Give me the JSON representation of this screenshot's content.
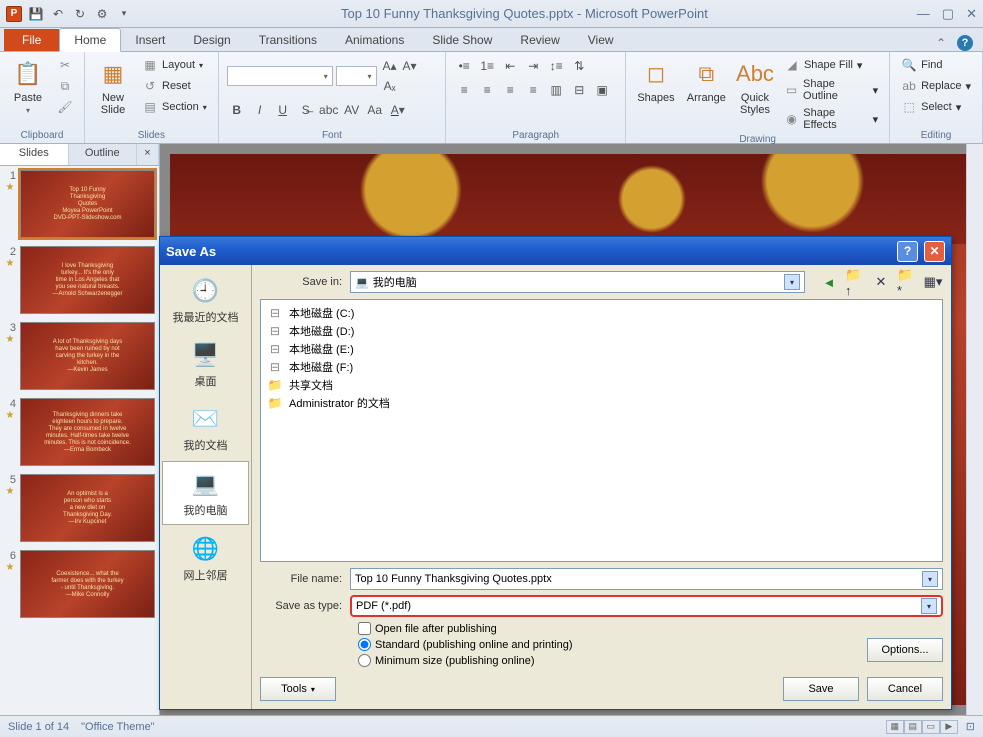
{
  "titlebar": {
    "app_letter": "P",
    "title": "Top 10 Funny Thanksgiving Quotes.pptx - Microsoft PowerPoint"
  },
  "ribbon_tabs": {
    "file": "File",
    "items": [
      "Home",
      "Insert",
      "Design",
      "Transitions",
      "Animations",
      "Slide Show",
      "Review",
      "View"
    ],
    "active_index": 0
  },
  "ribbon": {
    "clipboard": {
      "paste": "Paste",
      "label": "Clipboard"
    },
    "slides": {
      "newslide": "New\nSlide",
      "layout": "Layout",
      "reset": "Reset",
      "section": "Section",
      "label": "Slides"
    },
    "font": {
      "label": "Font"
    },
    "paragraph": {
      "label": "Paragraph"
    },
    "drawing": {
      "shapes": "Shapes",
      "arrange": "Arrange",
      "quick": "Quick\nStyles",
      "fill": "Shape Fill",
      "outline": "Shape Outline",
      "effects": "Shape Effects",
      "label": "Drawing"
    },
    "editing": {
      "find": "Find",
      "replace": "Replace",
      "select": "Select",
      "label": "Editing"
    }
  },
  "slidepanel": {
    "tab_slides": "Slides",
    "tab_outline": "Outline",
    "thumbs": [
      {
        "num": "1",
        "lines": [
          "Top 10 Funny",
          "Thanksgiving",
          "Quotes",
          "Moyea PowerPoint",
          "DVD-PPT-Slideshow.com"
        ]
      },
      {
        "num": "2",
        "lines": [
          "I love Thanksgiving",
          "turkey... It's the only",
          "time in Los Angeles that",
          "you see natural breasts.",
          "—Arnold Schwarzenegger"
        ]
      },
      {
        "num": "3",
        "lines": [
          "A lot of Thanksgiving days",
          "have been ruined by not",
          "carving the turkey in the",
          "kitchen.",
          "—Kevin James"
        ]
      },
      {
        "num": "4",
        "lines": [
          "Thanksgiving dinners take",
          "eighteen hours to prepare.",
          "They are consumed in twelve",
          "minutes. Half-times take twelve",
          "minutes. This is not coincidence.",
          "—Erma Bombeck"
        ]
      },
      {
        "num": "5",
        "lines": [
          "An optimist is a",
          "person who starts",
          "a new diet on",
          "Thanksgiving Day.",
          "—Irv Kupcinet"
        ]
      },
      {
        "num": "6",
        "lines": [
          "Coexistence... what the",
          "farmer does with the turkey",
          "- until Thanksgiving.",
          "—Mike Connolly"
        ]
      }
    ]
  },
  "status": {
    "slide_of": "Slide 1 of 14",
    "theme": "\"Office Theme\""
  },
  "dialog": {
    "title": "Save As",
    "save_in": "Save in:",
    "save_in_val": "我的电脑",
    "places": [
      {
        "icon": "🕘",
        "label": "我最近的文档"
      },
      {
        "icon": "🖥️",
        "label": "桌面"
      },
      {
        "icon": "✉️",
        "label": "我的文档"
      },
      {
        "icon": "💻",
        "label": "我的电脑",
        "sel": true
      },
      {
        "icon": "🌐",
        "label": "网上邻居"
      }
    ],
    "files": [
      {
        "icon": "drive",
        "name": "本地磁盘 (C:)"
      },
      {
        "icon": "drive",
        "name": "本地磁盘 (D:)"
      },
      {
        "icon": "drive",
        "name": "本地磁盘 (E:)"
      },
      {
        "icon": "drive",
        "name": "本地磁盘 (F:)"
      },
      {
        "icon": "folder",
        "name": "共享文档"
      },
      {
        "icon": "folder",
        "name": "Administrator 的文档"
      }
    ],
    "filename_label": "File name:",
    "filename_val": "Top 10 Funny Thanksgiving Quotes.pptx",
    "type_label": "Save as type:",
    "type_val": "PDF (*.pdf)",
    "open_after": "Open file after publishing",
    "standard": "Standard (publishing online and printing)",
    "minimum": "Minimum size (publishing online)",
    "options": "Options...",
    "tools": "Tools",
    "save": "Save",
    "cancel": "Cancel"
  }
}
